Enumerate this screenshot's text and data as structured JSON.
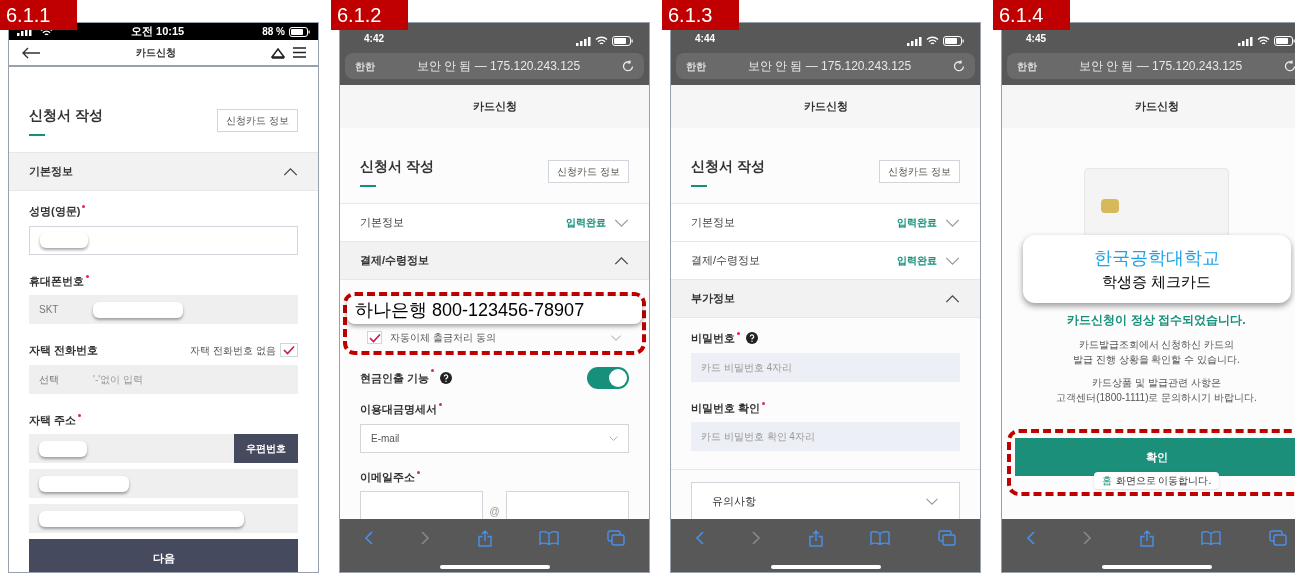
{
  "panels": [
    {
      "label": "6.1.1",
      "kind": "app",
      "time": "오전 10:15",
      "battery": "88 %",
      "title": "카드신청",
      "items": [
        {
          "kind": "title",
          "text": "신청서 작성",
          "button": "신청카드 정보"
        },
        {
          "kind": "section",
          "text": "기본정보",
          "expanded": true
        },
        {
          "kind": "label",
          "text": "성명(영문)",
          "required": true
        },
        {
          "kind": "textbox",
          "masked": true
        },
        {
          "kind": "label",
          "text": "휴대폰번호",
          "required": true
        },
        {
          "kind": "field",
          "prefix": "SKT",
          "masked": true
        },
        {
          "kind": "label",
          "text": "자택 전화번호",
          "check_label": "자택 전화번호 없음",
          "checked": true
        },
        {
          "kind": "field",
          "prefix": "선택",
          "placeholder": "'-'없이 입력"
        },
        {
          "kind": "label",
          "text": "자택 주소",
          "required": true
        },
        {
          "kind": "field",
          "masked": true,
          "button": "우편번호"
        },
        {
          "kind": "field",
          "masked": true
        },
        {
          "kind": "field",
          "masked": true
        },
        {
          "kind": "button",
          "text": "다음"
        }
      ]
    },
    {
      "label": "6.1.2",
      "kind": "browser",
      "time": "4:42",
      "reader": "한한",
      "url": "보안 안 됨 — 175.120.243.125",
      "title": "카드신청",
      "items": [
        {
          "kind": "title",
          "text": "신청서 작성",
          "button": "신청카드 정보"
        },
        {
          "kind": "section",
          "text": "기본정보",
          "status": "입력완료",
          "expanded": false
        },
        {
          "kind": "section",
          "text": "결제/수령정보",
          "expanded": true
        },
        {
          "kind": "callout",
          "text": "하나은행 800-123456-78907",
          "consent": "자동이체 출금처리 동의",
          "checked": true
        },
        {
          "kind": "toggle",
          "text": "현금인출 기능",
          "required": true,
          "help": true,
          "on": true
        },
        {
          "kind": "label",
          "text": "이용대금명세서",
          "required": true
        },
        {
          "kind": "select",
          "value": "E-mail"
        },
        {
          "kind": "label",
          "text": "이메일주소",
          "required": true
        },
        {
          "kind": "email",
          "separator": "@"
        }
      ]
    },
    {
      "label": "6.1.3",
      "kind": "browser",
      "time": "4:44",
      "reader": "한한",
      "url": "보안 안 됨 — 175.120.243.125",
      "title": "카드신청",
      "items": [
        {
          "kind": "title",
          "text": "신청서 작성",
          "button": "신청카드 정보"
        },
        {
          "kind": "section",
          "text": "기본정보",
          "status": "입력완료",
          "expanded": false
        },
        {
          "kind": "section",
          "text": "결제/수령정보",
          "status": "입력완료",
          "expanded": false
        },
        {
          "kind": "section",
          "text": "부가정보",
          "expanded": true
        },
        {
          "kind": "label",
          "text": "비밀번호",
          "required": true,
          "help": true
        },
        {
          "kind": "password",
          "placeholder": "카드 비밀번호 4자리"
        },
        {
          "kind": "label",
          "text": "비밀번호 확인",
          "required": true
        },
        {
          "kind": "password",
          "placeholder": "카드 비밀번호 확인 4자리"
        },
        {
          "kind": "accordion",
          "text": "유의사항"
        }
      ]
    },
    {
      "label": "6.1.4",
      "kind": "browser",
      "time": "4:45",
      "reader": "한한",
      "url": "보안 안 됨 — 175.120.243.125",
      "title": "카드신청",
      "items": [
        {
          "kind": "card_image"
        },
        {
          "kind": "callout_card",
          "title": "한국공학대학교",
          "subtitle": "학생증 체크카드"
        },
        {
          "kind": "success",
          "text": "카드신청이 정상 접수되었습니다."
        },
        {
          "kind": "paragraph",
          "text": "카드발급조회에서 신청하신 카드의\n발급 진행 상황을 확인할 수 있습니다."
        },
        {
          "kind": "paragraph",
          "text": "카드상품 및 발급관련 사항은\n고객센터(1800-1111)로 문의하시기 바랍니다."
        },
        {
          "kind": "confirm",
          "text": "확인",
          "tooltip_accent": "홈",
          "tooltip": "화면으로 이동합니다."
        }
      ]
    }
  ]
}
